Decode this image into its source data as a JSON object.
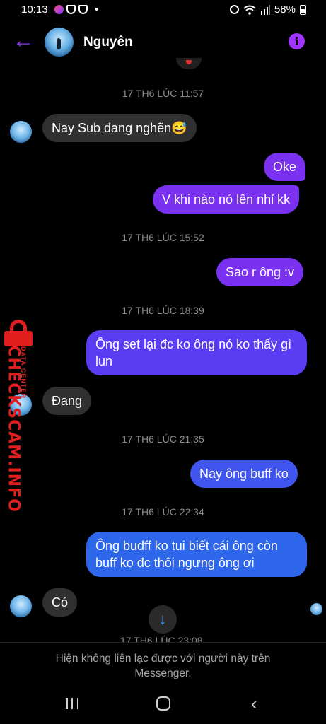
{
  "status_bar": {
    "time": "10:13",
    "dot": "•",
    "battery": "58%",
    "icons": [
      "messenger-notif-icon",
      "shield-icon",
      "shield-icon",
      "alarm-icon",
      "wifi-icon",
      "signal-icon",
      "battery-icon"
    ]
  },
  "header": {
    "title": "Nguyên",
    "back_icon": "←",
    "info_icon": "i"
  },
  "messages": [
    {
      "type": "timestamp",
      "text": "17 TH6 LÚC 11:57"
    },
    {
      "type": "incoming",
      "text": "Nay Sub đang nghẽn😅"
    },
    {
      "type": "outgoing",
      "text": "Oke"
    },
    {
      "type": "outgoing",
      "text": "V khi nào nó lên nhỉ kk"
    },
    {
      "type": "timestamp",
      "text": "17 TH6 LÚC 15:52"
    },
    {
      "type": "outgoing",
      "text": "Sao r ông :v"
    },
    {
      "type": "timestamp",
      "text": "17 TH6 LÚC 18:39"
    },
    {
      "type": "outgoing",
      "text": "Ông set lại đc ko ông nó ko thấy gì lun"
    },
    {
      "type": "incoming",
      "text": "Đang"
    },
    {
      "type": "timestamp",
      "text": "17 TH6 LÚC 21:35"
    },
    {
      "type": "outgoing",
      "text": "Nay ông buff ko"
    },
    {
      "type": "timestamp",
      "text": "17 TH6 LÚC 22:34"
    },
    {
      "type": "outgoing",
      "text": "Ông budff ko tui biết cái ông còn buff ko đc thôi ngưng ông ơi"
    },
    {
      "type": "incoming",
      "text": "Có"
    },
    {
      "type": "timestamp",
      "text": "17 TH6 LÚC 23:08"
    }
  ],
  "scroll_down_icon": "↓",
  "footer_notice": "Hiện không liên lạc được với người này trên Messenger.",
  "watermark": {
    "brand": "CHECKSCAM.INFO",
    "sub": "DATA CENTER"
  },
  "nav": {
    "back_icon": "‹"
  },
  "colors": {
    "accent": "#9a33ff",
    "incoming_bubble": "#303030",
    "outgoing_top": "#7a32f0",
    "outgoing_bottom": "#2e66ec",
    "watermark": "#e01e1e"
  }
}
